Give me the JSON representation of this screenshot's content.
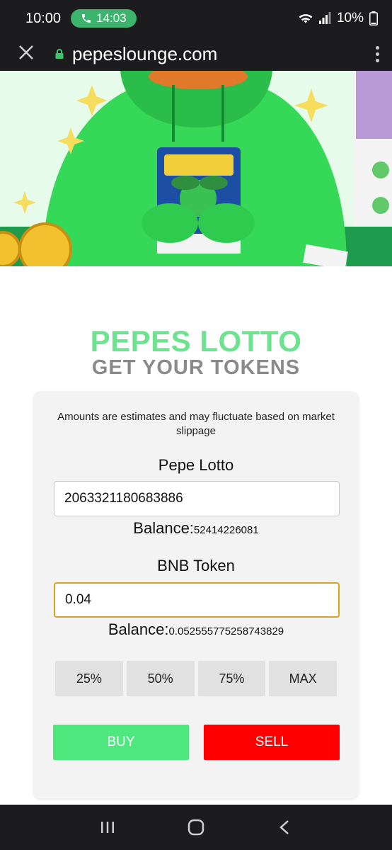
{
  "status_bar": {
    "time": "10:00",
    "call_time": "14:03",
    "battery": "10%"
  },
  "browser": {
    "url": "pepeslounge.com"
  },
  "headings": {
    "title": "PEPES LOTTO",
    "subtitle": "GET YOUR TOKENS"
  },
  "swap": {
    "notice": "Amounts are estimates and may fluctuate based on market slippage",
    "token_from": {
      "label": "Pepe Lotto",
      "value": "2063321180683886",
      "balance_label": "Balance:",
      "balance_value": "52414226081"
    },
    "token_to": {
      "label": "BNB Token",
      "value": "0.04",
      "balance_label": "Balance:",
      "balance_value": "0.052555775258743829"
    },
    "percent_buttons": [
      "25%",
      "50%",
      "75%",
      "MAX"
    ],
    "buy_label": "BUY",
    "sell_label": "SELL"
  },
  "colors": {
    "title_green": "#6ee38f",
    "buy_green": "#4ee87f",
    "sell_red": "#ff0000",
    "focus_orange": "#e0a11b",
    "call_green": "#3db46d"
  },
  "icons": [
    "phone-icon",
    "wifi-icon",
    "signal-icon",
    "battery-icon",
    "close-icon",
    "lock-icon",
    "more-vert-icon",
    "recent-apps-icon",
    "home-icon",
    "back-icon"
  ]
}
